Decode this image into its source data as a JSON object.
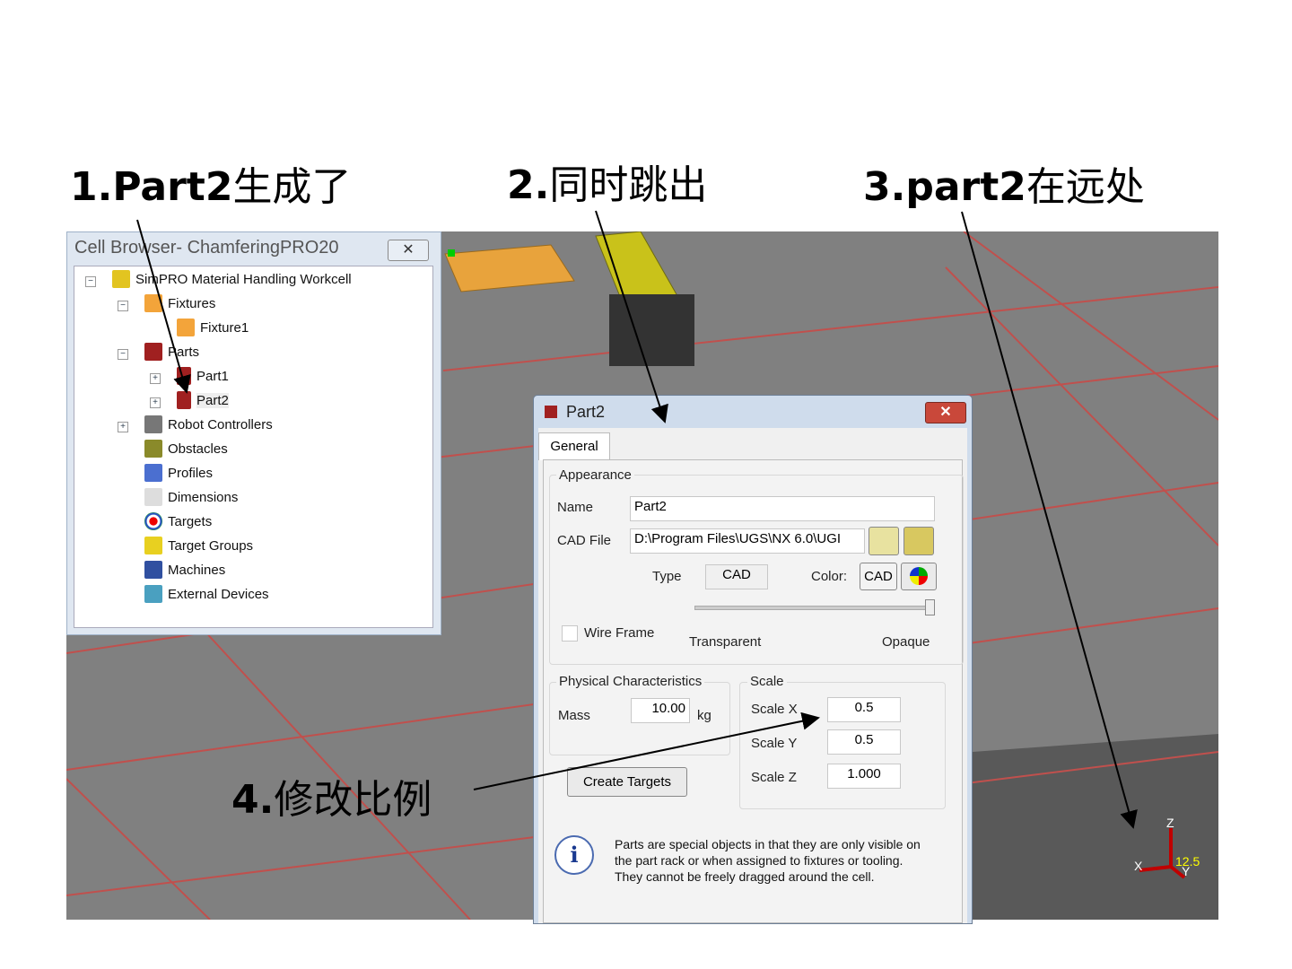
{
  "annotations": {
    "a1_num": "1.Part2",
    "a1_text": "生成了",
    "a2_num": "2.",
    "a2_text": "同时跳出",
    "a3_num": "3.part2",
    "a3_text": "在远处",
    "a4_num": "4.",
    "a4_text": "修改比例"
  },
  "cell_browser": {
    "title": "Cell Browser- ChamferingPRO20",
    "close": "✕",
    "items": [
      {
        "label": "SimPRO Material Handling Workcell"
      },
      {
        "label": "Fixtures"
      },
      {
        "label": "Fixture1"
      },
      {
        "label": "Parts"
      },
      {
        "label": "Part1"
      },
      {
        "label": "Part2"
      },
      {
        "label": "Robot Controllers"
      },
      {
        "label": "Obstacles"
      },
      {
        "label": "Profiles"
      },
      {
        "label": "Dimensions"
      },
      {
        "label": "Targets"
      },
      {
        "label": "Target Groups"
      },
      {
        "label": "Machines"
      },
      {
        "label": "External Devices"
      }
    ]
  },
  "dialog": {
    "title": "Part2",
    "close": "✕",
    "tab": "General",
    "appearance": "Appearance",
    "name_label": "Name",
    "name_value": "Part2",
    "cad_label": "CAD File",
    "cad_value": "D:\\Program Files\\UGS\\NX 6.0\\UGI",
    "type_label": "Type",
    "type_value": "CAD",
    "color_label": "Color:",
    "color_value": "CAD",
    "wire_frame": "Wire Frame",
    "transparent": "Transparent",
    "opaque": "Opaque",
    "opacity": 1.0,
    "physical": "Physical Characteristics",
    "mass_label": "Mass",
    "mass_value": "10.00",
    "mass_unit": "kg",
    "scale": "Scale",
    "scale_x_label": "Scale X",
    "scale_x": "0.5",
    "scale_y_label": "Scale Y",
    "scale_y": "0.5",
    "scale_z_label": "Scale Z",
    "scale_z": "1.000",
    "create_targets": "Create Targets",
    "info": "Parts are special objects in that they are only visible on the part rack or when assigned to fixtures or tooling. They cannot be freely dragged around the cell."
  },
  "triad": {
    "z": "Z",
    "x": "X",
    "y": "Y",
    "value": "12.5"
  }
}
